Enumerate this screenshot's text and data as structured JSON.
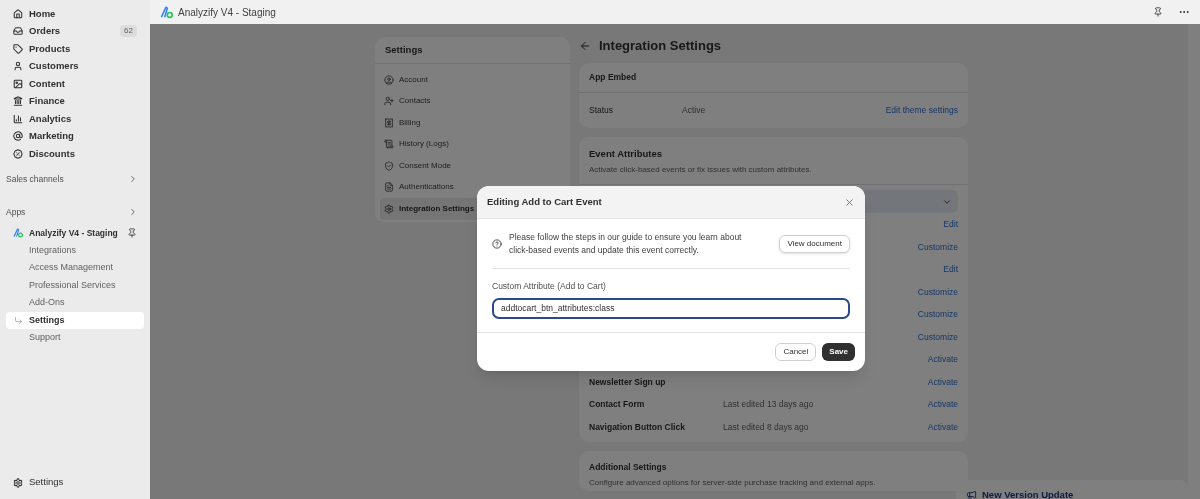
{
  "sidebar": {
    "items": [
      {
        "label": "Home"
      },
      {
        "label": "Orders",
        "badge": "62"
      },
      {
        "label": "Products"
      },
      {
        "label": "Customers"
      },
      {
        "label": "Content"
      },
      {
        "label": "Finance"
      },
      {
        "label": "Analytics"
      },
      {
        "label": "Marketing"
      },
      {
        "label": "Discounts"
      }
    ],
    "sections": [
      {
        "label": "Sales channels"
      },
      {
        "label": "Apps"
      }
    ],
    "app": {
      "name": "Analyzify V4 - Staging",
      "subitems": [
        {
          "label": "Integrations",
          "selected": false
        },
        {
          "label": "Access Management",
          "selected": false
        },
        {
          "label": "Professional Services",
          "selected": false
        },
        {
          "label": "Add-Ons",
          "selected": false
        },
        {
          "label": "Settings",
          "selected": true
        },
        {
          "label": "Support",
          "selected": false
        }
      ]
    },
    "footer": {
      "label": "Settings"
    }
  },
  "topbar": {
    "title": "Analyzify V4 - Staging"
  },
  "settings_nav": {
    "title": "Settings",
    "items": [
      {
        "label": "Account",
        "selected": false
      },
      {
        "label": "Contacts",
        "selected": false
      },
      {
        "label": "Billing",
        "selected": false
      },
      {
        "label": "History (Logs)",
        "selected": false
      },
      {
        "label": "Consent Mode",
        "selected": false
      },
      {
        "label": "Authentications",
        "selected": false
      },
      {
        "label": "Integration Settings",
        "selected": true
      }
    ]
  },
  "page": {
    "title": "Integration Settings",
    "app_embed": {
      "title": "App Embed",
      "label": "Status",
      "value": "Active",
      "link": "Edit theme settings"
    },
    "event_attributes": {
      "title": "Event Attributes",
      "description": "Activate click-based events or fix issues with custom attributes.",
      "rows": [
        {
          "action": "Edit"
        },
        {
          "action": "Customize"
        },
        {
          "action": "Edit"
        },
        {
          "action": "Customize"
        },
        {
          "action": "Customize"
        },
        {
          "action": "Customize"
        },
        {
          "action": "Activate"
        },
        {
          "name": "Newsletter Sign up",
          "action": "Activate"
        },
        {
          "name": "Contact Form",
          "detail": "Last edited 13 days ago",
          "action": "Activate"
        },
        {
          "name": "Navigation Button Click",
          "detail": "Last edited 8 days ago",
          "action": "Activate"
        }
      ]
    },
    "additional_settings": {
      "title": "Additional Settings",
      "description": "Configure advanced options for server-side purchase tracking and external apps."
    },
    "update_button": "New Version Update"
  },
  "modal": {
    "title": "Editing Add to Cart Event",
    "info": "Please follow the steps in our guide to ensure you learn about click-based events and update this event correctly.",
    "doc_button": "View document",
    "field_label": "Custom Attribute (Add to Cart)",
    "field_value": "addtocart_btn_attributes:class",
    "cancel": "Cancel",
    "save": "Save"
  }
}
